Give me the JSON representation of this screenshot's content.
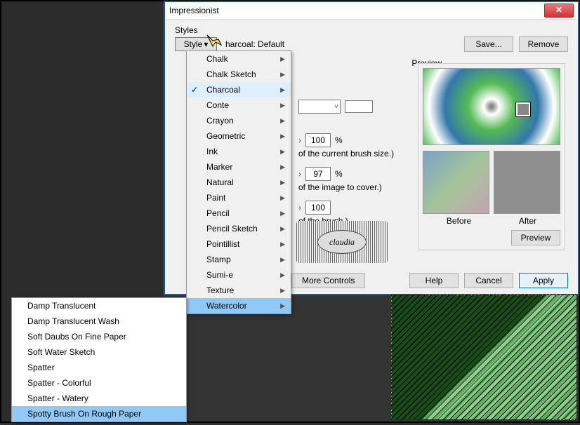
{
  "dialog": {
    "title": "Impressionist",
    "styles_label": "Styles",
    "style_button": "Style",
    "current_style": "harcoal: Default",
    "save": "Save...",
    "remove": "Remove"
  },
  "style_menu": [
    {
      "label": "Chalk",
      "sub": true
    },
    {
      "label": "Chalk Sketch",
      "sub": true
    },
    {
      "label": "Charcoal",
      "sub": true,
      "checked": true
    },
    {
      "label": "Conte",
      "sub": true
    },
    {
      "label": "Crayon",
      "sub": true
    },
    {
      "label": "Geometric",
      "sub": true
    },
    {
      "label": "Ink",
      "sub": true
    },
    {
      "label": "Marker",
      "sub": true
    },
    {
      "label": "Natural",
      "sub": true
    },
    {
      "label": "Paint",
      "sub": true
    },
    {
      "label": "Pencil",
      "sub": true
    },
    {
      "label": "Pencil Sketch",
      "sub": true
    },
    {
      "label": "Pointillist",
      "sub": true
    },
    {
      "label": "Stamp",
      "sub": true
    },
    {
      "label": "Sumi-e",
      "sub": true
    },
    {
      "label": "Texture",
      "sub": true
    },
    {
      "label": "Watercolor",
      "sub": true,
      "selected": true
    }
  ],
  "watercolor_submenu": [
    {
      "label": "Damp Translucent"
    },
    {
      "label": "Damp Translucent Wash"
    },
    {
      "label": "Soft Daubs On Fine Paper"
    },
    {
      "label": "Soft Water Sketch"
    },
    {
      "label": "Spatter"
    },
    {
      "label": "Spatter - Colorful"
    },
    {
      "label": "Spatter - Watery"
    },
    {
      "label": "Spotty Brush On Rough Paper",
      "selected": true
    }
  ],
  "controls": {
    "val1": "100",
    "pct": "%",
    "note1": "of the current brush size.)",
    "val2": "97",
    "note2": "of the image to cover.)",
    "val3": "100",
    "note3": "of the brush.)",
    "more": "More Controls"
  },
  "preview": {
    "group": "Preview",
    "before": "Before",
    "after": "After",
    "button": "Preview"
  },
  "buttons": {
    "help": "Help",
    "cancel": "Cancel",
    "apply": "Apply"
  },
  "watermark": "claudia"
}
